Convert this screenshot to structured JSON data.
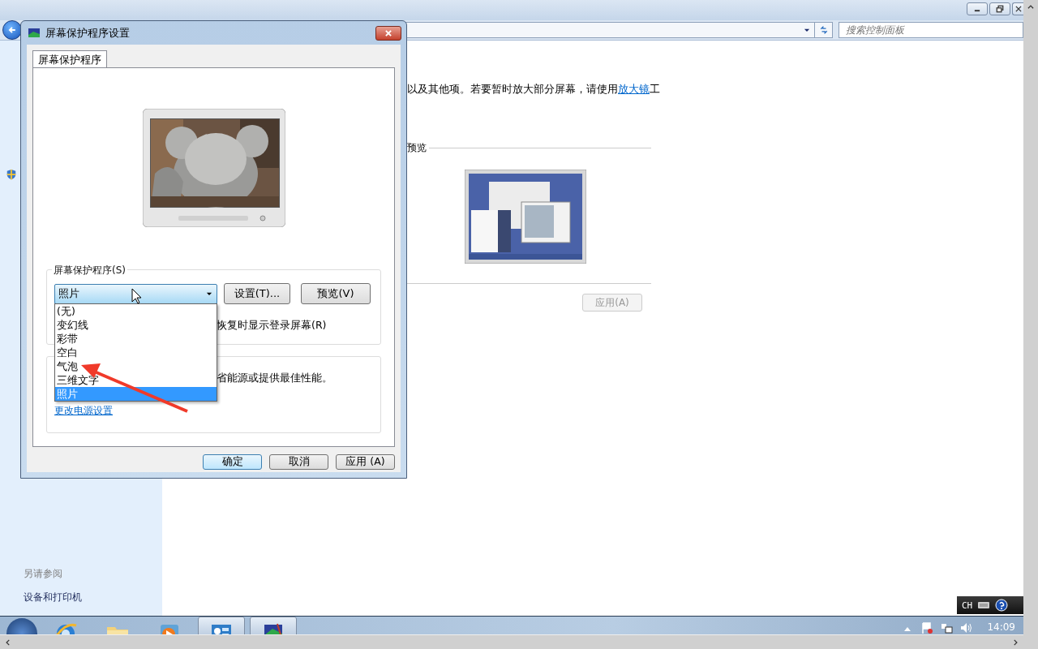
{
  "window": {
    "search_placeholder": "搜索控制面板"
  },
  "content": {
    "intro_text": "以及其他项。若要暂时放大部分屏幕，请使用",
    "intro_link": "放大镜",
    "intro_tail": "工",
    "preview_label": "预览",
    "apply_button": {
      "label": "应用(A)",
      "disabled": true
    }
  },
  "sidebar": {
    "see_also": "另请参阅",
    "links": [
      "设备和打印机"
    ]
  },
  "dialog": {
    "title": "屏幕保护程序设置",
    "tabs": [
      {
        "label": "屏幕保护程序",
        "selected": true
      }
    ],
    "screensaver_group": "屏幕保护程序(S)",
    "dropdown": {
      "value": "照片",
      "expanded": true,
      "options": [
        {
          "label": "(无)",
          "selected": false
        },
        {
          "label": "变幻线",
          "selected": false
        },
        {
          "label": "彩带",
          "selected": false
        },
        {
          "label": "空白",
          "selected": false
        },
        {
          "label": "气泡",
          "selected": false
        },
        {
          "label": "三维文字",
          "selected": false
        },
        {
          "label": "照片",
          "selected": true
        }
      ]
    },
    "settings_button": "设置(T)...",
    "preview_button": "预览(V)",
    "logon_checkbox_label": "恢复时显示登录屏幕(R)",
    "power_text": "省能源或提供最佳性能。",
    "power_link": "更改电源设置",
    "buttons": [
      {
        "label": "确定",
        "default": true
      },
      {
        "label": "取消",
        "default": false
      },
      {
        "label": "应用 (A)",
        "default": false
      }
    ]
  },
  "taskbar": {
    "items": [
      {
        "kind": "browser",
        "active": false
      },
      {
        "kind": "folder",
        "active": false
      },
      {
        "kind": "media",
        "active": false
      },
      {
        "kind": "control-panel",
        "active": true
      },
      {
        "kind": "screensaver",
        "active": true
      }
    ]
  },
  "tray": {
    "language": "CH",
    "clock": "14:09"
  }
}
